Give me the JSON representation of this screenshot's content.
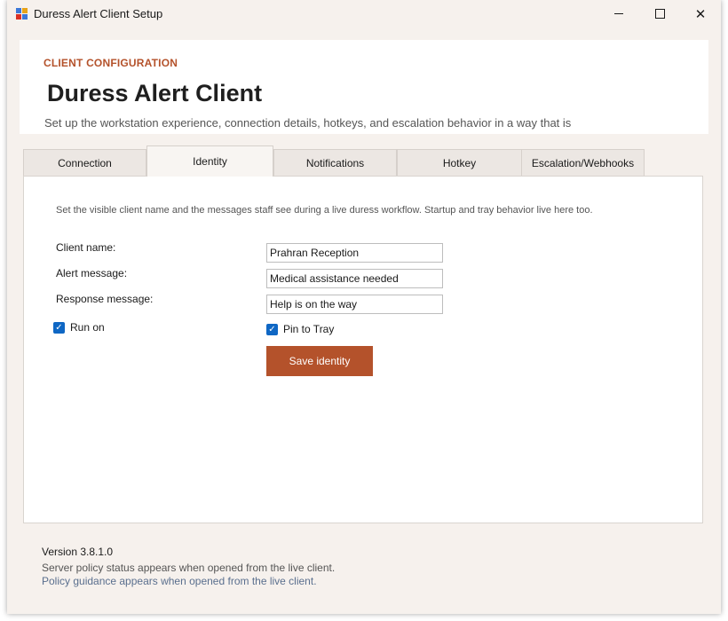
{
  "window": {
    "title": "Duress Alert Client Setup",
    "minimize_glyph": "",
    "close_glyph": "✕"
  },
  "header": {
    "eyebrow": "CLIENT CONFIGURATION",
    "title": "Duress Alert Client",
    "subtitle": "Set up the workstation experience, connection details, hotkeys, and escalation behavior in a way that is"
  },
  "tabs": [
    {
      "label": "Connection"
    },
    {
      "label": "Identity"
    },
    {
      "label": "Notifications"
    },
    {
      "label": "Hotkey"
    },
    {
      "label": "Escalation/Webhooks"
    }
  ],
  "active_tab": "Identity",
  "identity": {
    "intro": "Set the visible client name and the messages staff see during a live duress workflow. Startup and tray behavior live here too.",
    "client_name_label": "Client name:",
    "client_name_value": "Prahran Reception",
    "alert_message_label": "Alert message:",
    "alert_message_value": "Medical assistance needed",
    "response_message_label": "Response message:",
    "response_message_value": "Help is on the way",
    "run_on_label": "Run on",
    "run_on_checked": true,
    "pin_to_tray_label": "Pin to Tray",
    "pin_to_tray_checked": true,
    "save_button": "Save identity"
  },
  "footer": {
    "version": "Version 3.8.1.0",
    "server_policy_status": "Server policy status appears when opened from the live client.",
    "policy_guidance": "Policy guidance appears when opened from the live client."
  },
  "colors": {
    "accent": "#b4522b",
    "checkbox": "#0f67c4",
    "window_background": "#f6f1ed",
    "link_text": "#5a6f8e"
  }
}
